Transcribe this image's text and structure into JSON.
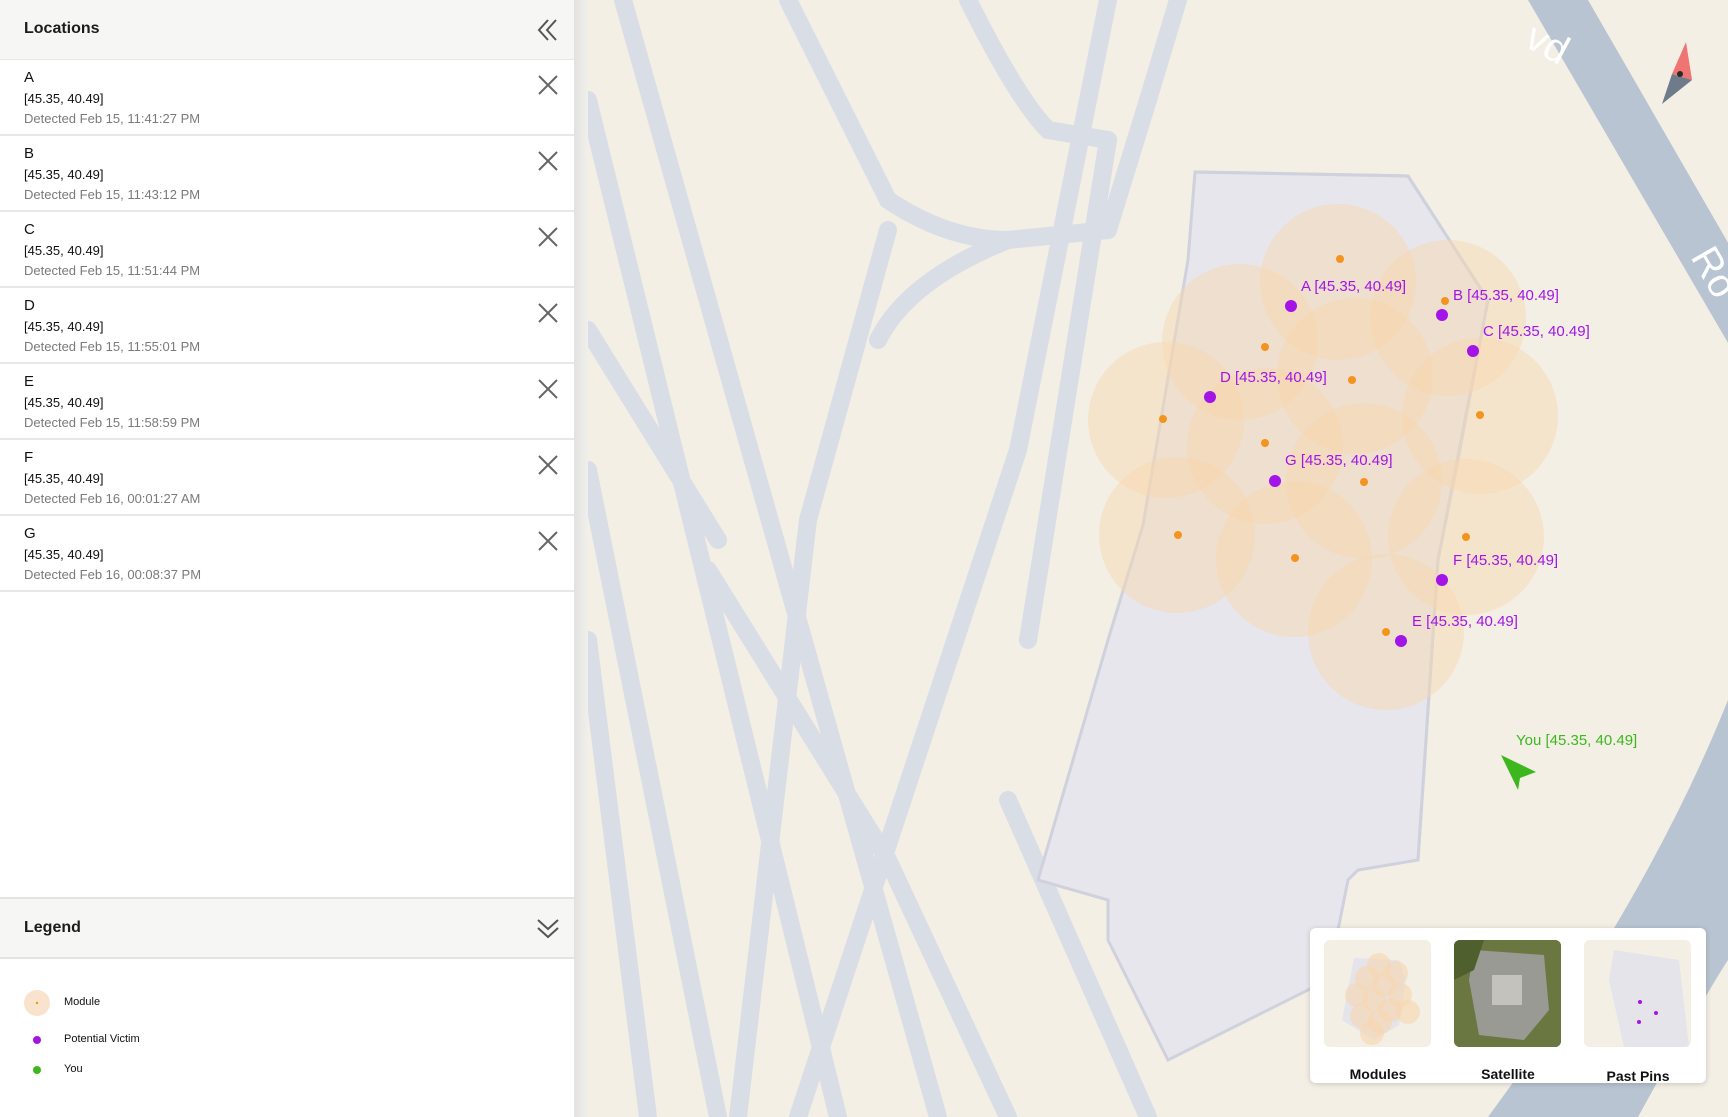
{
  "sidebar": {
    "title": "Locations",
    "collapse_icon": "double-chevron-left-icon",
    "locations": [
      {
        "name": "A",
        "coords": "[45.35, 40.49]",
        "detected": "Detected Feb 15, 11:41:27 PM"
      },
      {
        "name": "B",
        "coords": "[45.35, 40.49]",
        "detected": "Detected Feb 15, 11:43:12 PM"
      },
      {
        "name": "C",
        "coords": "[45.35, 40.49]",
        "detected": "Detected Feb 15, 11:51:44 PM"
      },
      {
        "name": "D",
        "coords": "[45.35, 40.49]",
        "detected": "Detected Feb 15, 11:55:01 PM"
      },
      {
        "name": "E",
        "coords": "[45.35, 40.49]",
        "detected": "Detected Feb 15, 11:58:59 PM"
      },
      {
        "name": "F",
        "coords": "[45.35, 40.49]",
        "detected": "Detected Feb 16, 00:01:27 AM"
      },
      {
        "name": "G",
        "coords": "[45.35, 40.49]",
        "detected": "Detected Feb 16, 00:08:37 PM"
      }
    ],
    "remove_icon": "close-icon"
  },
  "legend": {
    "title": "Legend",
    "collapse_icon": "double-chevron-down-icon",
    "items": [
      {
        "label": "Module",
        "color": "#f9d9b6"
      },
      {
        "label": "Potential Victim",
        "color": "#a314e6"
      },
      {
        "label": "You",
        "color": "#3cb81e"
      }
    ]
  },
  "map": {
    "pins": [
      {
        "label": "A [45.35, 40.49]"
      },
      {
        "label": "B [45.35, 40.49]"
      },
      {
        "label": "C [45.35, 40.49]"
      },
      {
        "label": "D [45.35, 40.49]"
      },
      {
        "label": "G [45.35, 40.49]"
      },
      {
        "label": "F [45.35, 40.49]"
      },
      {
        "label": "E [45.35, 40.49]"
      }
    ],
    "you_label": "You [45.35, 40.49]",
    "road_labels": [
      "vd",
      "Ro"
    ],
    "compass_icon": "compass-icon",
    "colors": {
      "victim": "#a314e6",
      "module": "#f3941f",
      "you": "#3cb81e",
      "road": "#d9dde5",
      "highway": "#b8c4d1"
    }
  },
  "layers": [
    {
      "label": "Modules"
    },
    {
      "label": "Satellite"
    },
    {
      "label": "Past Pins"
    }
  ]
}
